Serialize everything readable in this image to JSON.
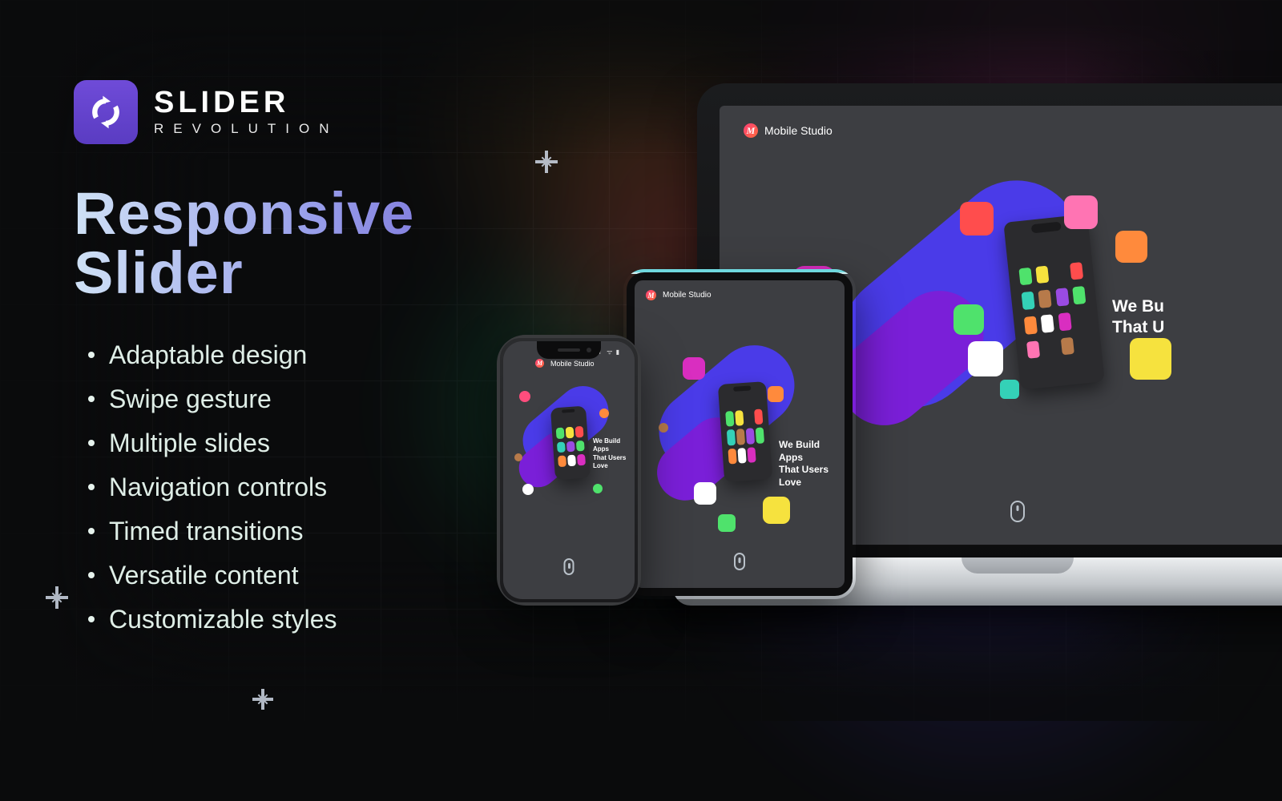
{
  "brand": {
    "name_top": "SLIDER",
    "name_bottom": "REVOLUTION"
  },
  "headline": "Responsive Slider",
  "features": [
    "Adaptable design",
    "Swipe gesture",
    "Multiple slides",
    "Navigation controls",
    "Timed transitions",
    "Versatile content",
    "Customizable styles"
  ],
  "mockup": {
    "brand_initial": "M",
    "brand_name": "Mobile Studio",
    "tagline_line1": "We Build Apps",
    "tagline_line2": "That Users Love",
    "tagline_cut_line1": "We Bu",
    "tagline_cut_line2": "That U"
  },
  "colors": {
    "accent_purple": "#6f4bd8",
    "blob_blue": "#4a3be8",
    "blob_purple": "#7a1fd8",
    "magenta": "#d92ec0",
    "pink": "#ff74b3",
    "orange": "#ff8a3c",
    "yellow": "#f6e23e",
    "green": "#4fe26c",
    "teal": "#34d1b7",
    "red": "#ff4d4d",
    "white": "#ffffff",
    "brown": "#b77a4a"
  }
}
